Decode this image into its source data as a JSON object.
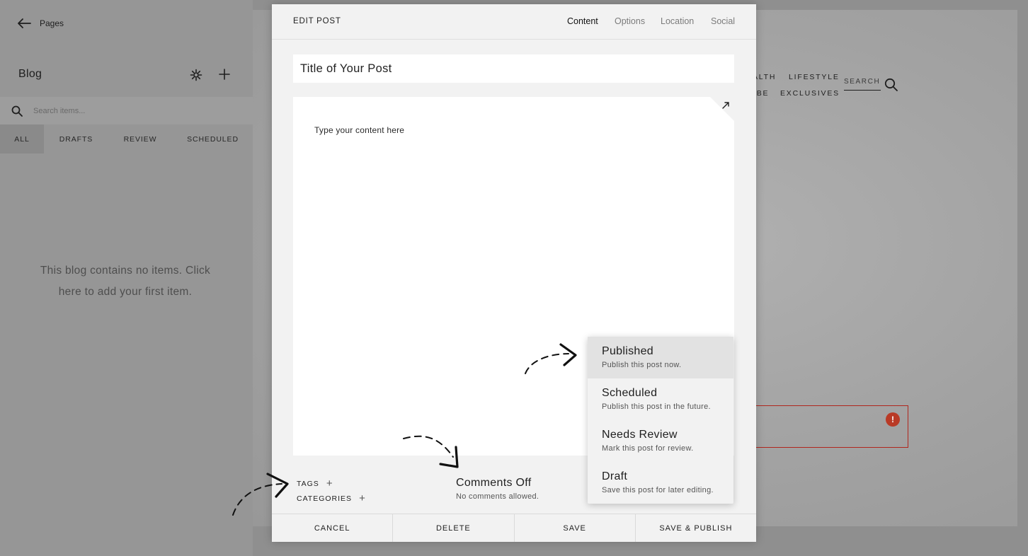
{
  "sidebar": {
    "back_label": "Pages",
    "blog_title": "Blog",
    "search_placeholder": "Search items...",
    "filters": [
      "ALL",
      "DRAFTS",
      "REVIEW",
      "SCHEDULED"
    ],
    "active_filter": "ALL",
    "empty_message": "This blog contains no items. Click here to add your first item."
  },
  "preview": {
    "nav_fragments": [
      "ALTH",
      "LIFESTYLE",
      "IBE",
      "EXCLUSIVES"
    ],
    "search_label": "SEARCH",
    "error_badge": "!"
  },
  "modal": {
    "title": "EDIT POST",
    "tabs": [
      "Content",
      "Options",
      "Location",
      "Social"
    ],
    "active_tab": "Content",
    "post_title": "Title of Your Post",
    "content_placeholder": "Type your content here",
    "tags_label": "TAGS",
    "categories_label": "CATEGORIES",
    "comments_title": "Comments Off",
    "comments_sub": "No comments allowed.",
    "footer": [
      "CANCEL",
      "DELETE",
      "SAVE",
      "SAVE & PUBLISH"
    ]
  },
  "status_menu": [
    {
      "label": "Published",
      "desc": "Publish this post now."
    },
    {
      "label": "Scheduled",
      "desc": "Publish this post in the future."
    },
    {
      "label": "Needs Review",
      "desc": "Mark this post for review."
    },
    {
      "label": "Draft",
      "desc": "Save this post for later editing."
    }
  ],
  "colors": {
    "error_red": "#b0261d",
    "modal_bg": "#f2f2f2",
    "backdrop": "#8f8f8f"
  }
}
